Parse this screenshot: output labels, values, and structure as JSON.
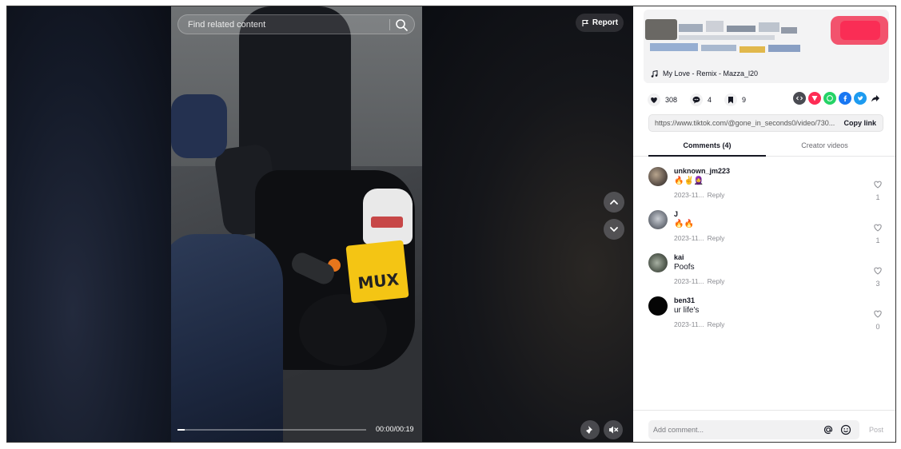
{
  "video": {
    "search_placeholder": "Find related content",
    "report_label": "Report",
    "time": "00:00/00:19",
    "progress": 0.04,
    "plate_text": "MUX"
  },
  "panel": {
    "music": "My Love - Remix - Mazza_l20",
    "stats": {
      "likes": "308",
      "comments": "4",
      "saves": "9"
    },
    "share_link": "https://www.tiktok.com/@gone_in_seconds0/video/730...",
    "copy_link_label": "Copy link",
    "tabs": {
      "comments": "Comments (4)",
      "creator": "Creator videos"
    },
    "comments": [
      {
        "user": "unknown_jm223",
        "text": "🔥✌🧕",
        "date": "2023-11...",
        "reply": "Reply",
        "likes": "1"
      },
      {
        "user": "J",
        "text": "🔥🔥",
        "date": "2023-11...",
        "reply": "Reply",
        "likes": "1"
      },
      {
        "user": "kai",
        "text": "Poofs",
        "date": "2023-11...",
        "reply": "Reply",
        "likes": "3"
      },
      {
        "user": "ben31",
        "text": "ur life's",
        "date": "2023-11...",
        "reply": "Reply",
        "likes": "0"
      }
    ],
    "comment_placeholder": "Add comment...",
    "post_label": "Post"
  },
  "colors": {
    "accent_red": "#fe2c55",
    "text_primary": "#161823",
    "text_secondary": "#8a8b91",
    "whatsapp": "#25d366",
    "facebook": "#1877f2",
    "twitter": "#1d9bf0"
  }
}
